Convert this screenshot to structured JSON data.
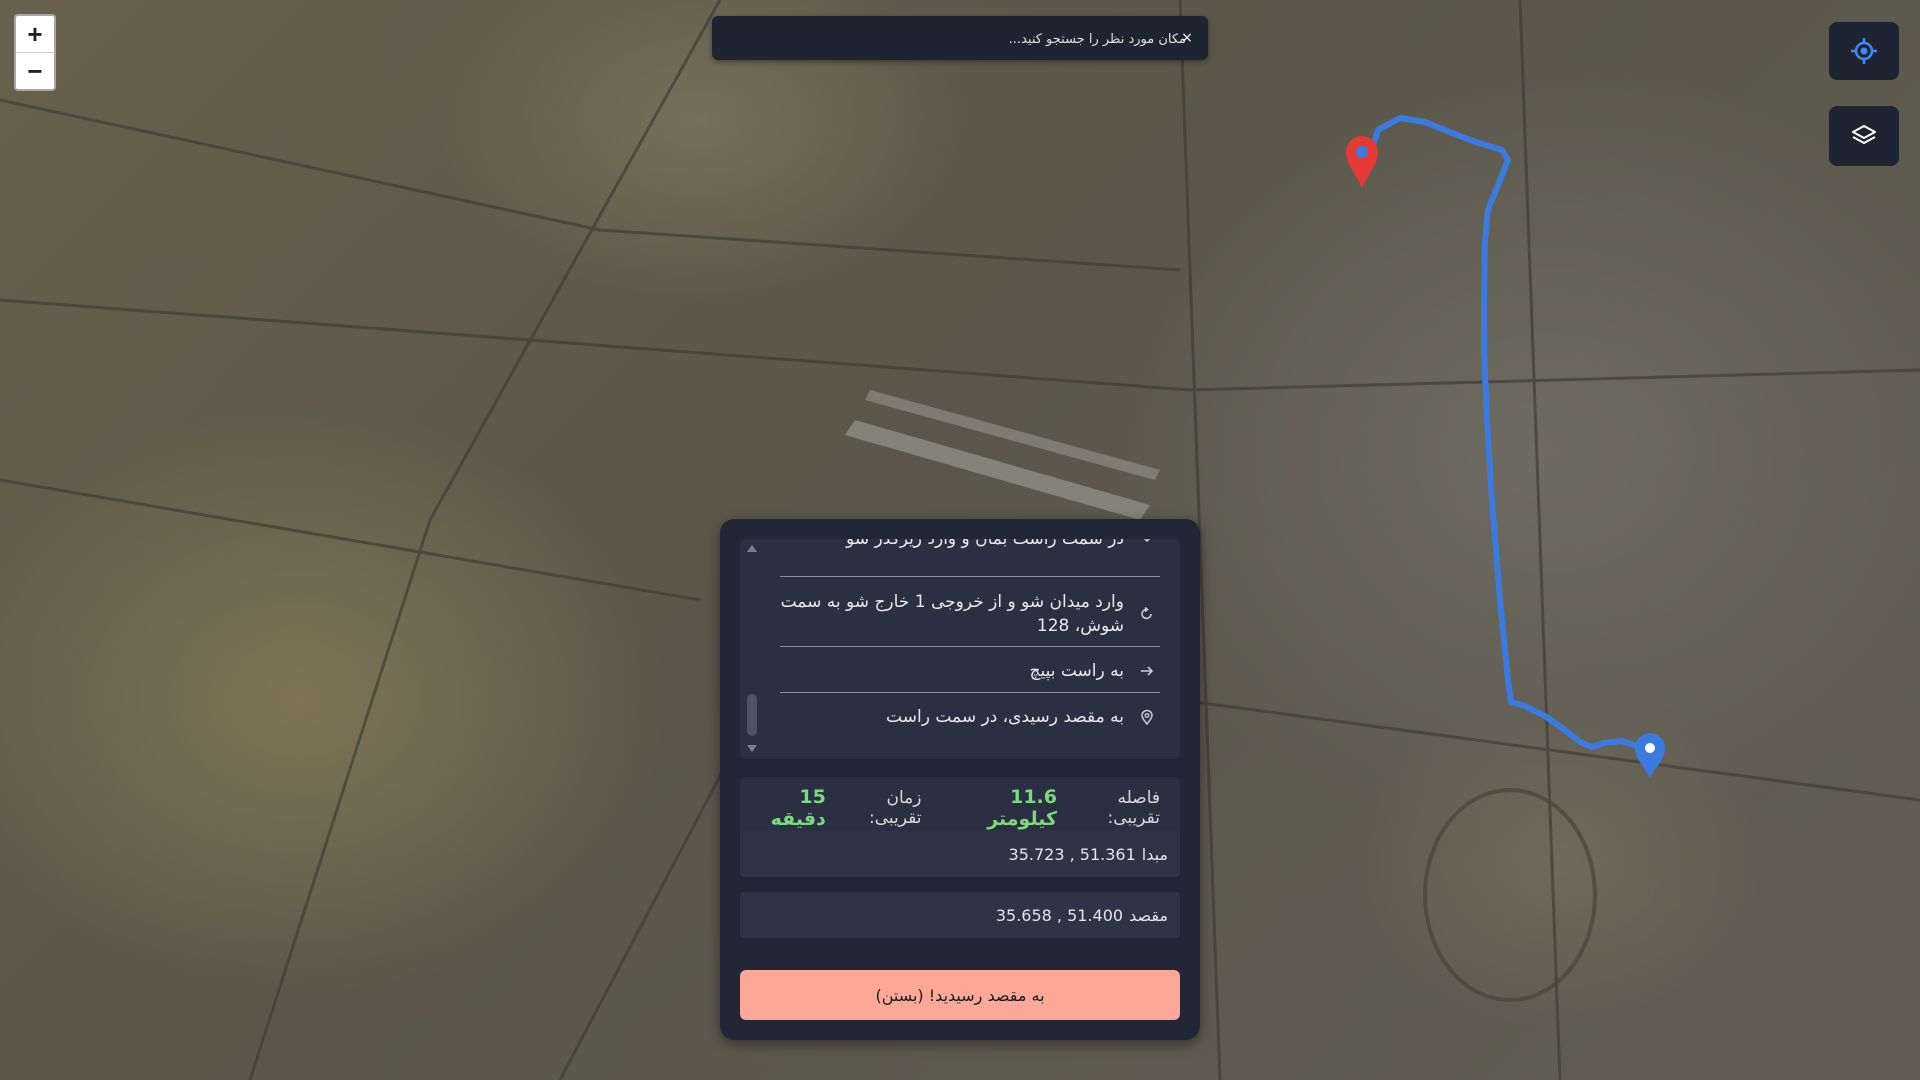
{
  "map": {
    "zoom_in_label": "+",
    "zoom_out_label": "−",
    "locate_icon": "crosshair-icon",
    "layers_icon": "layers-icon",
    "route_color": "#3b7be0",
    "start_marker_color": "#e53935",
    "end_marker_color": "#3b7be0"
  },
  "search": {
    "placeholder": "مکان مورد نظر را جستجو کنید...",
    "close_label": "×"
  },
  "directions": {
    "steps": [
      {
        "text": "در سمت راست بمان و وارد زیرگذر شو",
        "icon": "chevron-icon"
      },
      {
        "text": "وارد میدان شو و از خروجی 1 خارج شو به سمت شوش، 128",
        "icon": "roundabout-icon"
      },
      {
        "text": "به راست بپیچ",
        "icon": "arrow-right-icon"
      },
      {
        "text": "به مقصد رسیدی، در سمت راست",
        "icon": "location-pin-icon"
      }
    ]
  },
  "summary": {
    "distance_label": "فاصله تقریبی:",
    "distance_value": "11.6 کیلومتر",
    "time_label": "زمان تقریبی:",
    "time_value": "15 دقیقه"
  },
  "origin": {
    "label": "مبدا",
    "value": "35.723 , 51.361"
  },
  "destination": {
    "label": "مقصد",
    "value": "35.658 , 51.400"
  },
  "arrive_button": "به مقصد رسیدید! (بستن)"
}
